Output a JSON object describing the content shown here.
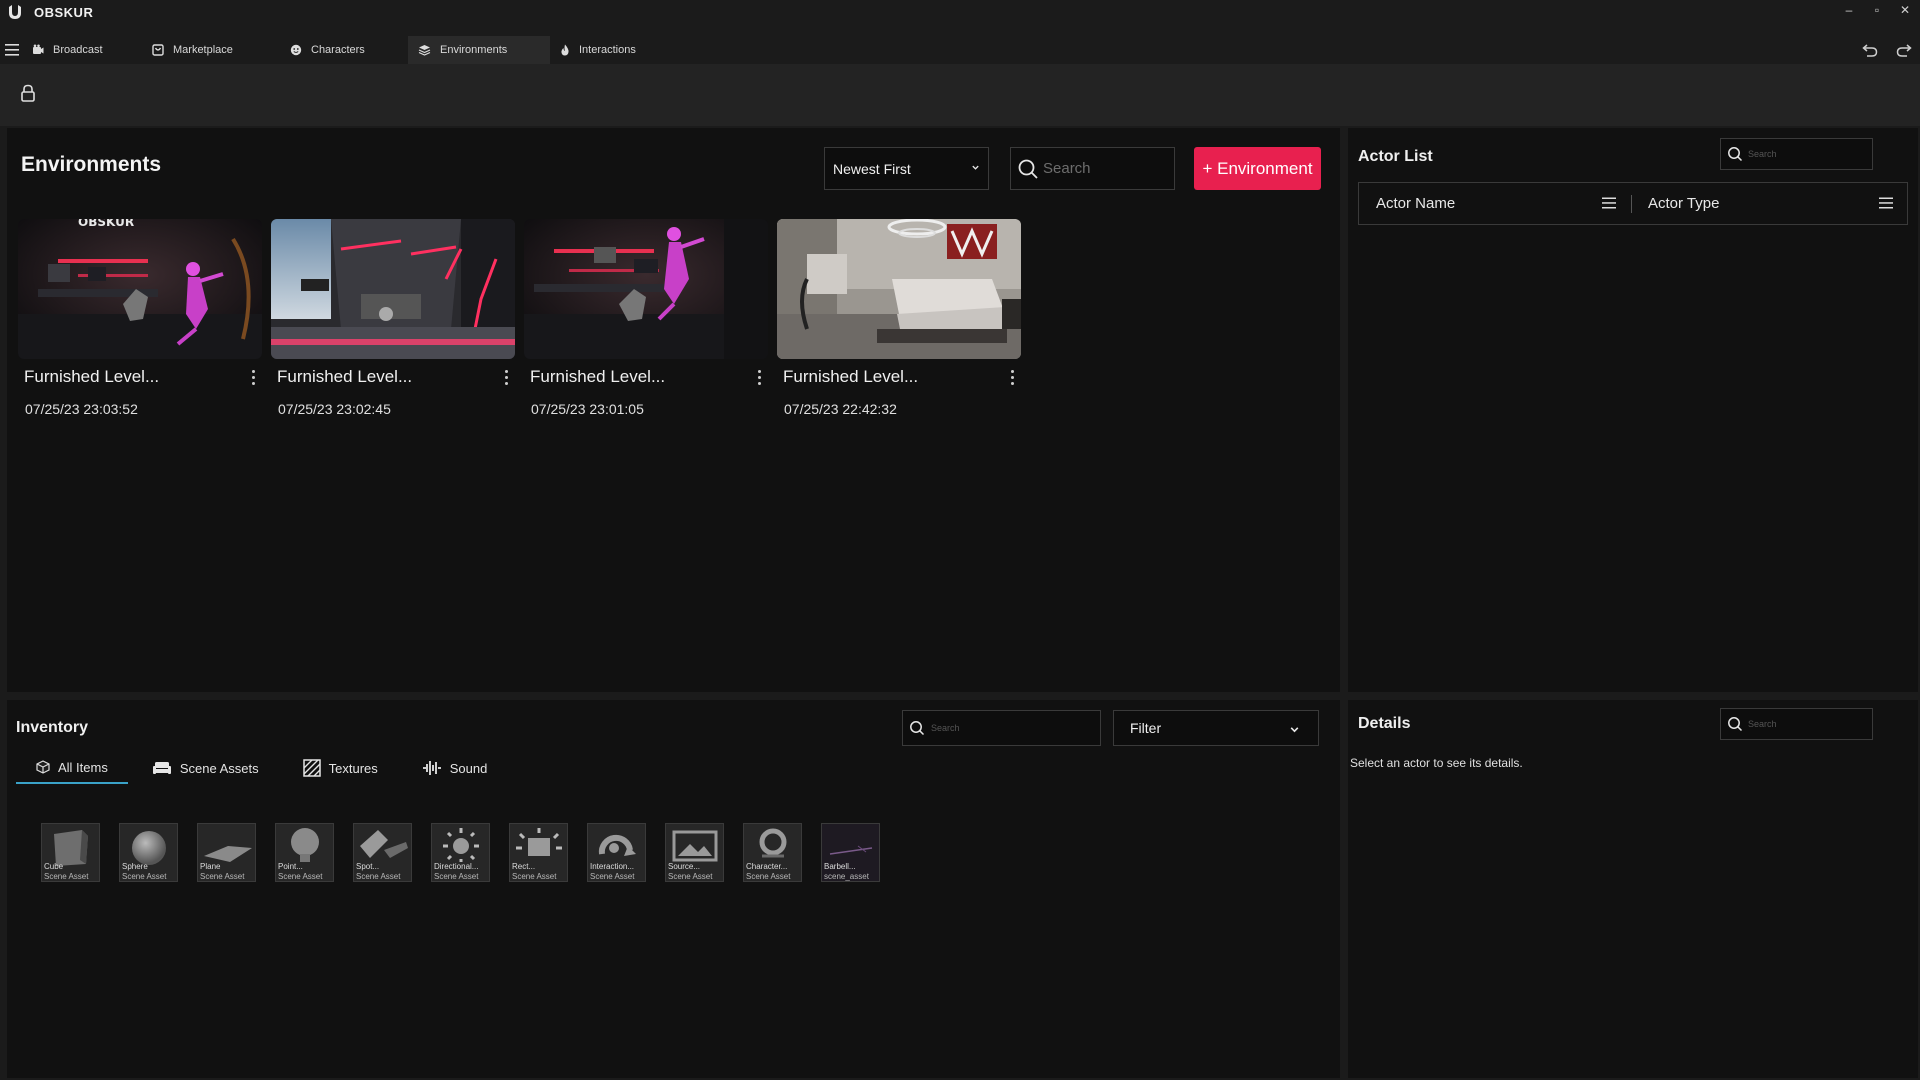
{
  "app": {
    "title": "OBSKUR",
    "window_controls": {
      "minimize": "–",
      "maximize": "▫",
      "close": "✕"
    }
  },
  "tabs": [
    {
      "label": "Broadcast",
      "icon": "broadcast-icon"
    },
    {
      "label": "Marketplace",
      "icon": "marketplace-icon"
    },
    {
      "label": "Characters",
      "icon": "characters-icon"
    },
    {
      "label": "Environments",
      "icon": "environments-icon",
      "active": true
    },
    {
      "label": "Interactions",
      "icon": "interactions-icon"
    }
  ],
  "environments": {
    "title": "Environments",
    "sort_value": "Newest First",
    "search_placeholder": "Search",
    "add_button_label": "+ Environment",
    "cards": [
      {
        "name": "Furnished Level...",
        "date": "07/25/23 23:03:52",
        "logo_text": "OBSKUR"
      },
      {
        "name": "Furnished Level...",
        "date": "07/25/23 23:02:45"
      },
      {
        "name": "Furnished Level...",
        "date": "07/25/23 23:01:05"
      },
      {
        "name": "Furnished Level...",
        "date": "07/25/23 22:42:32"
      }
    ]
  },
  "actor_list": {
    "title": "Actor List",
    "search_placeholder": "Search",
    "columns": [
      "Actor Name",
      "Actor Type"
    ]
  },
  "inventory": {
    "title": "Inventory",
    "search_placeholder": "Search",
    "filter_value": "Filter",
    "tabs": [
      {
        "label": "All Items",
        "active": true
      },
      {
        "label": "Scene Assets"
      },
      {
        "label": "Textures"
      },
      {
        "label": "Sound"
      }
    ],
    "items": [
      {
        "name": "Cube",
        "type": "Scene Asset"
      },
      {
        "name": "Sphere",
        "type": "Scene Asset"
      },
      {
        "name": "Plane",
        "type": "Scene Asset"
      },
      {
        "name": "Point...",
        "type": "Scene Asset"
      },
      {
        "name": "Spot...",
        "type": "Scene Asset"
      },
      {
        "name": "Directional...",
        "type": "Scene Asset"
      },
      {
        "name": "Rect...",
        "type": "Scene Asset"
      },
      {
        "name": "Interaction...",
        "type": "Scene Asset"
      },
      {
        "name": "Source...",
        "type": "Scene Asset"
      },
      {
        "name": "Character...",
        "type": "Scene Asset"
      },
      {
        "name": "Barbell...",
        "type": "scene_asset"
      }
    ]
  },
  "details": {
    "title": "Details",
    "search_placeholder": "Search",
    "empty_message": "Select an actor to see its details."
  },
  "colors": {
    "accent": "#e8204f",
    "tab_underline": "#3aa2c8",
    "panel_bg": "#111111",
    "app_bg": "#1b1b1b"
  }
}
